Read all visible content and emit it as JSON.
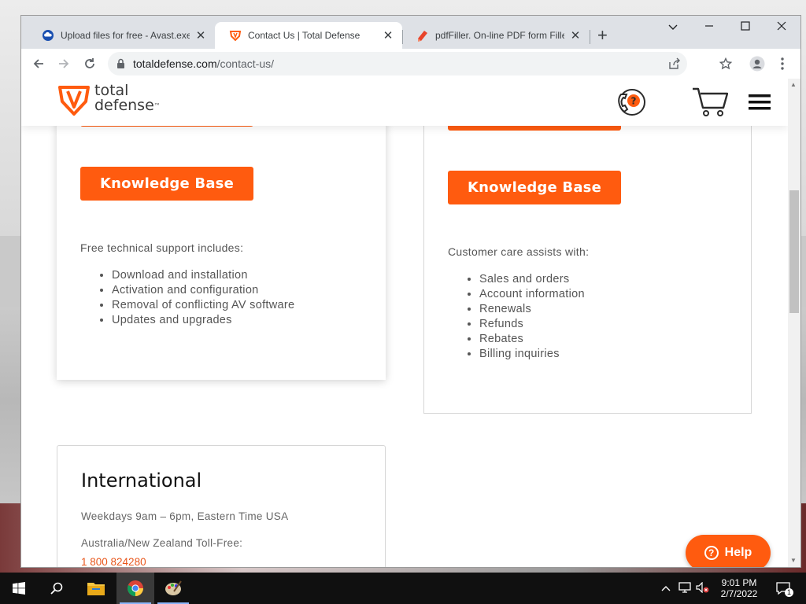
{
  "browser": {
    "tabs": [
      {
        "title": "Upload files for free - Avast.exe -",
        "close": "✕",
        "icon": "cloud-upload-icon"
      },
      {
        "title": "Contact Us | Total Defense",
        "close": "✕",
        "icon": "total-defense-shield-icon",
        "active": true
      },
      {
        "title": "pdfFiller. On-line PDF form Filler",
        "close": "✕",
        "icon": "pdffiller-icon"
      }
    ],
    "new_tab": "+",
    "url_host": "totaldefense.com",
    "url_path": "/contact-us/"
  },
  "site": {
    "logo_line1": "total",
    "logo_line2": "defense",
    "logo_tm": "™",
    "accent_color": "#ff5b0f"
  },
  "support_card": {
    "button_label": "Knowledge Base",
    "intro": "Free technical support includes:",
    "items": [
      "Download and installation",
      "Activation and configuration",
      "Removal of conflicting AV software",
      "Updates and upgrades"
    ]
  },
  "care_card": {
    "button_label": "Knowledge Base",
    "intro": "Customer care assists with:",
    "items": [
      "Sales and orders",
      "Account information",
      "Renewals",
      "Refunds",
      "Rebates",
      "Billing inquiries"
    ]
  },
  "international": {
    "title": "International",
    "hours": "Weekdays 9am – 6pm, Eastern Time USA",
    "region": "Australia/New Zealand Toll-Free:",
    "phone": "1 800 824280"
  },
  "help_button": {
    "label": "Help"
  },
  "taskbar": {
    "time": "9:01 PM",
    "date": "2/7/2022",
    "notification_count": "1"
  }
}
